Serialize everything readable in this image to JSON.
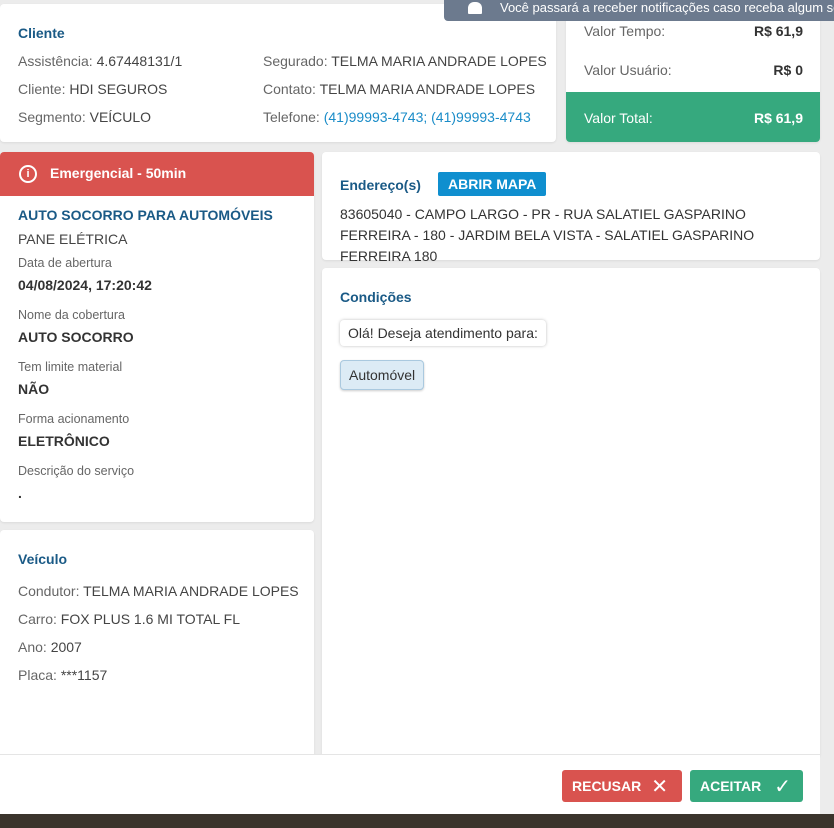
{
  "notification": {
    "text": "Você passará a receber notificações caso receba algum se",
    "icon": "bell-icon"
  },
  "cliente": {
    "title": "Cliente",
    "assistencia_label": "Assistência:",
    "assistencia": "4.67448131/1",
    "cliente_label": "Cliente:",
    "cliente": "HDI SEGUROS",
    "segmento_label": "Segmento:",
    "segmento": "VEÍCULO",
    "segurado_label": "Segurado:",
    "segurado": "TELMA MARIA ANDRADE LOPES",
    "contato_label": "Contato:",
    "contato": "TELMA MARIA ANDRADE LOPES",
    "telefone_label": "Telefone:",
    "telefone": "(41)99993-4743; (41)99993-4743"
  },
  "valores": {
    "tempo_label": "Valor Tempo:",
    "tempo": "R$ 61,9",
    "usuario_label": "Valor Usuário:",
    "usuario": "R$ 0",
    "total_label": "Valor Total:",
    "total": "R$ 61,9"
  },
  "servico": {
    "badge": "Emergencial - 50min",
    "title": "AUTO SOCORRO PARA AUTOMÓVEIS",
    "subtitle": "PANE ELÉTRICA",
    "fields": [
      {
        "label": "Data de abertura",
        "value": "04/08/2024, 17:20:42"
      },
      {
        "label": "Nome da cobertura",
        "value": "AUTO SOCORRO"
      },
      {
        "label": "Tem limite material",
        "value": "NÃO"
      },
      {
        "label": "Forma acionamento",
        "value": "ELETRÔNICO"
      },
      {
        "label": "Descrição do serviço",
        "value": "."
      }
    ]
  },
  "endereco": {
    "title": "Endereço(s)",
    "map_button": "ABRIR MAPA",
    "address": "83605040 - CAMPO LARGO - PR - RUA SALATIEL GASPARINO FERREIRA - 180 - JARDIM BELA VISTA - SALATIEL GASPARINO FERREIRA 180"
  },
  "condicoes": {
    "title": "Condições",
    "question": "Olá! Deseja atendimento para:",
    "answer": "Automóvel"
  },
  "veiculo": {
    "title": "Veículo",
    "condutor_label": "Condutor:",
    "condutor": "TELMA MARIA ANDRADE LOPES",
    "carro_label": "Carro:",
    "carro": "FOX PLUS 1.6 MI TOTAL FL",
    "ano_label": "Ano:",
    "ano": "2007",
    "placa_label": "Placa:",
    "placa": "***1157"
  },
  "footer": {
    "reject": "RECUSAR",
    "accept": "ACEITAR"
  },
  "colors": {
    "danger": "#d9534f",
    "success": "#36a97e",
    "primary": "#0f8fcf",
    "title": "#1a5a86"
  }
}
